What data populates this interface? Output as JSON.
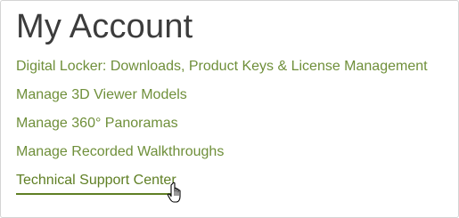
{
  "page": {
    "title": "My Account"
  },
  "links": [
    {
      "label": "Digital Locker: Downloads, Product Keys & License Management",
      "hovered": false
    },
    {
      "label": "Manage 3D Viewer Models",
      "hovered": false
    },
    {
      "label": "Manage 360° Panoramas",
      "hovered": false
    },
    {
      "label": "Manage Recorded Walkthroughs",
      "hovered": false
    },
    {
      "label": "Technical Support Center",
      "hovered": true
    }
  ],
  "colors": {
    "link": "#6f8f3a",
    "link_hover": "#5f7f24",
    "title": "#3c3c3c",
    "border": "#d4d4d4"
  },
  "cursor": {
    "icon": "hand-pointer-icon"
  }
}
